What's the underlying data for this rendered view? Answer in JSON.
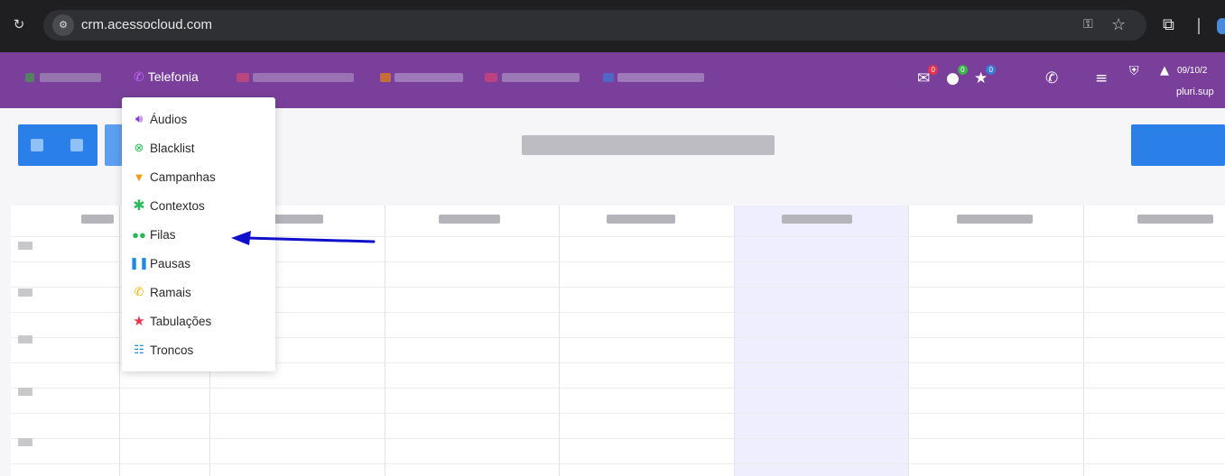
{
  "browser": {
    "url": "crm.acessocloud.com",
    "icons": [
      "reload-icon",
      "site-info-icon",
      "key-icon",
      "star-icon",
      "extensions-icon"
    ]
  },
  "nav": {
    "menu_label": "Telefonia",
    "brand_color": "#7a3f9a",
    "badges": {
      "mail": "0",
      "chat": "0",
      "favorites": "0"
    },
    "date": "09/10/2",
    "user": "pluri.sup"
  },
  "dropdown": {
    "items": [
      {
        "label": "Áudios",
        "icon": "volume-icon",
        "color": "#8a3ccf"
      },
      {
        "label": "Blacklist",
        "icon": "x-circle-icon",
        "color": "#2eb85c"
      },
      {
        "label": "Campanhas",
        "icon": "funnel-icon",
        "color": "#f39c12"
      },
      {
        "label": "Contextos",
        "icon": "asterisk-icon",
        "color": "#2eb85c"
      },
      {
        "label": "Filas",
        "icon": "users-icon",
        "color": "#2eb85c"
      },
      {
        "label": "Pausas",
        "icon": "pause-icon",
        "color": "#1e88e5"
      },
      {
        "label": "Ramais",
        "icon": "phone-volume-icon",
        "color": "#f4b400"
      },
      {
        "label": "Tabulações",
        "icon": "star-icon",
        "color": "#e8334a"
      },
      {
        "label": "Troncos",
        "icon": "network-icon",
        "color": "#1e88e5"
      }
    ]
  },
  "annotation": {
    "arrow_color": "#1010cc"
  }
}
